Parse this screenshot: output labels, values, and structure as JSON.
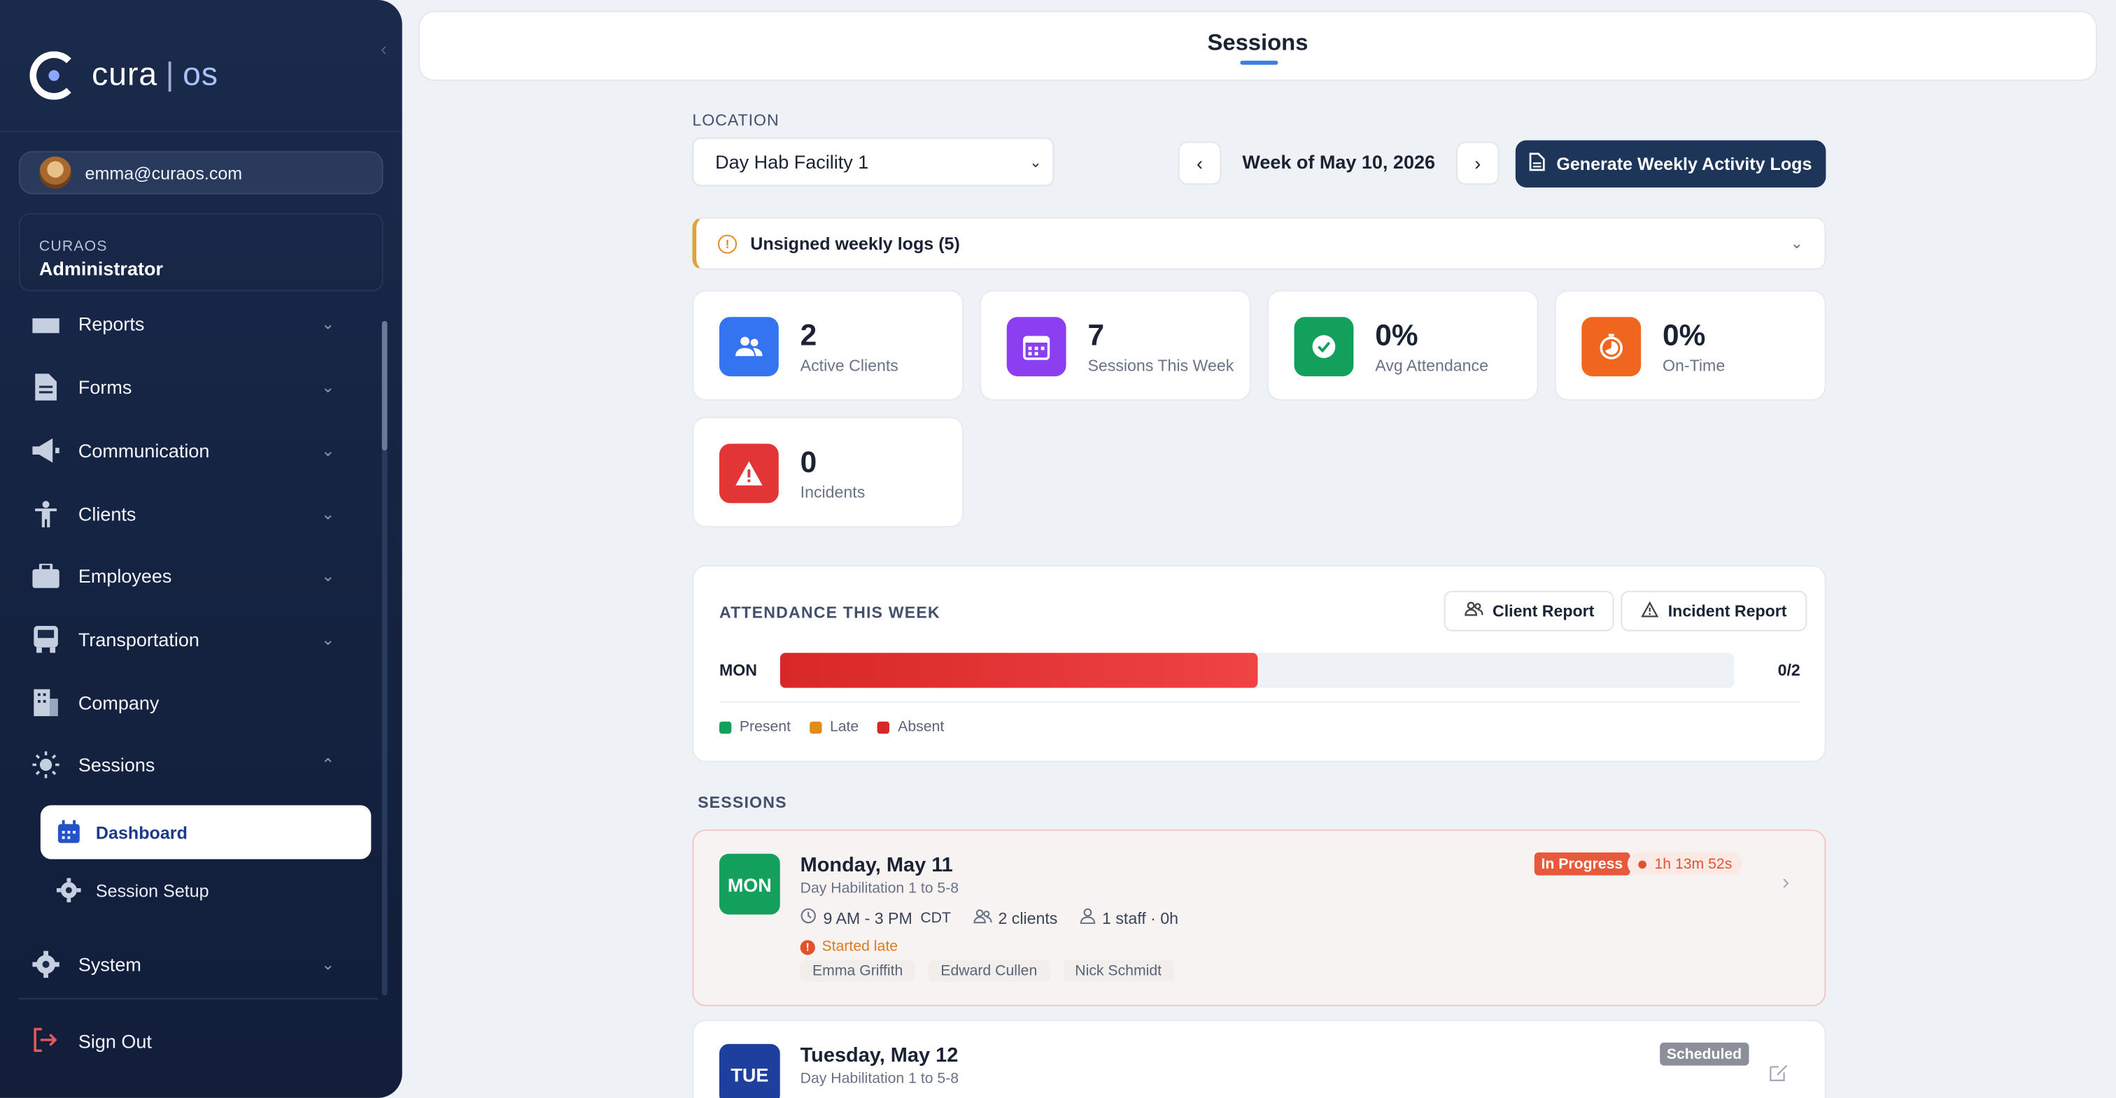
{
  "sidebar": {
    "logo_text": "cura",
    "logo_sep": "|",
    "logo_suffix": "os",
    "user_email": "emma@curaos.com",
    "org_name": "CURAOS",
    "org_role": "Administrator",
    "nav": [
      {
        "label": "Reports",
        "icon": "reports-icon"
      },
      {
        "label": "Forms",
        "icon": "forms-icon"
      },
      {
        "label": "Communication",
        "icon": "megaphone-icon"
      },
      {
        "label": "Clients",
        "icon": "person-icon"
      },
      {
        "label": "Employees",
        "icon": "briefcase-icon"
      },
      {
        "label": "Transportation",
        "icon": "bus-icon"
      },
      {
        "label": "Company",
        "icon": "building-icon"
      },
      {
        "label": "Sessions",
        "icon": "sun-icon"
      },
      {
        "label": "System",
        "icon": "gear-icon"
      }
    ],
    "sessions_sub": [
      {
        "label": "Dashboard",
        "icon": "calendar-icon"
      },
      {
        "label": "Session Setup",
        "icon": "gear-icon"
      }
    ],
    "signout": "Sign Out"
  },
  "header": {
    "title": "Sessions"
  },
  "filters": {
    "location_label": "LOCATION",
    "location_value": "Day Hab Facility 1",
    "week_label": "Week of May 10, 2026",
    "generate_label": "Generate Weekly Activity Logs"
  },
  "alert": {
    "text": "Unsigned weekly logs (5)"
  },
  "stats": [
    {
      "value": "2",
      "label": "Active Clients",
      "color": "#3574f0",
      "icon": "users-icon"
    },
    {
      "value": "7",
      "label": "Sessions This Week",
      "color": "#8b3ff0",
      "icon": "calendar-icon"
    },
    {
      "value": "0%",
      "label": "Avg Attendance",
      "color": "#12a05c",
      "icon": "check-circle-icon"
    },
    {
      "value": "0%",
      "label": "On-Time",
      "color": "#f0661e",
      "icon": "stopwatch-icon"
    },
    {
      "value": "0",
      "label": "Incidents",
      "color": "#e23636",
      "icon": "warning-icon"
    }
  ],
  "attendance": {
    "title": "ATTENDANCE THIS WEEK",
    "client_report": "Client Report",
    "incident_report": "Incident Report",
    "rows": [
      {
        "day": "MON",
        "ratio": "0/2",
        "absent_fraction": 0.5
      }
    ],
    "legend": [
      {
        "label": "Present",
        "color": "#12a05c"
      },
      {
        "label": "Late",
        "color": "#e08c1a"
      },
      {
        "label": "Absent",
        "color": "#d82727"
      }
    ]
  },
  "sessions": {
    "label": "SESSIONS",
    "items": [
      {
        "badge": "MON",
        "badge_color": "#12a05c",
        "title": "Monday, May 11",
        "subtitle": "Day Habilitation 1 to 5-8",
        "time": "9 AM - 3 PM",
        "tz": "CDT",
        "clients": "2 clients",
        "staff": "1 staff · 0h",
        "warning": "Started late",
        "attendees": [
          "Emma Griffith",
          "Edward Cullen",
          "Nick Schmidt"
        ],
        "status": "In Progress",
        "timer": "1h 13m 52s"
      },
      {
        "badge": "TUE",
        "badge_color": "#1e3f9e",
        "title": "Tuesday, May 12",
        "subtitle": "Day Habilitation 1 to 5-8",
        "status": "Scheduled"
      }
    ]
  },
  "colors": {
    "primary": "#1c3559",
    "accent": "#3c7fe0"
  }
}
